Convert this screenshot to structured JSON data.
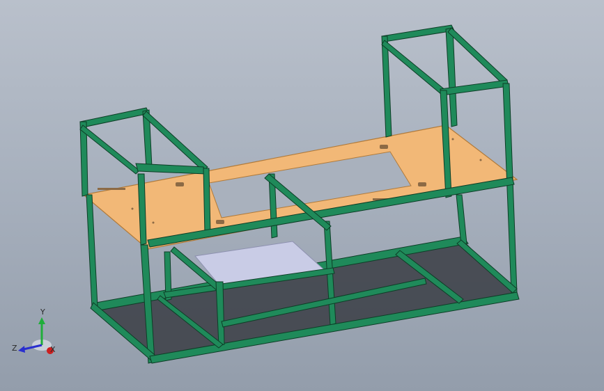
{
  "viewport": {
    "background_top": "#b9c0cb",
    "background_bottom": "#939dab"
  },
  "model": {
    "frame_color": "#1f8a5a",
    "frame_edge": "#0d3d26",
    "plate_color": "#f2b877",
    "plate_edge": "#b07a3a",
    "panel_color": "#c9cce6",
    "shadow_color": "#3b3f47"
  },
  "triad": {
    "x_label": "X",
    "y_label": "Y",
    "z_label": "Z",
    "x_color": "#cc1f1f",
    "y_color": "#1fae3a",
    "z_color": "#2a2fcf"
  }
}
